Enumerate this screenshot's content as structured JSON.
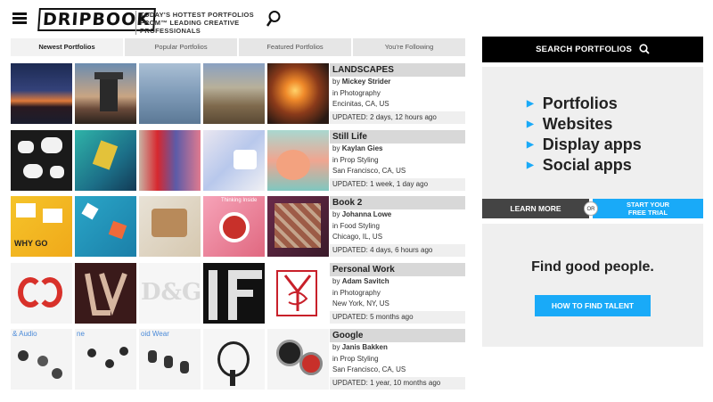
{
  "header": {
    "logo": "DRIPBOOK",
    "tagline": "TODAY'S HOTTEST PORTFOLIOS FROM™ LEADING CREATIVE PROFESSIONALS"
  },
  "tabs": [
    {
      "label": "Newest Portfolios",
      "active": true
    },
    {
      "label": "Popular Portfolios",
      "active": false
    },
    {
      "label": "Featured Portfolios",
      "active": false
    },
    {
      "label": "You're Following",
      "active": false
    }
  ],
  "portfolios": [
    {
      "title": "LANDSCAPES",
      "by": "by",
      "author": "Mickey Strider",
      "category": "in Photography",
      "location": "Encinitas, CA, US",
      "updated": "UPDATED: 2 days, 12 hours ago"
    },
    {
      "title": "Still Life",
      "by": "by",
      "author": "Kaylan Gies",
      "category": "in Prop Styling",
      "location": "San Francisco, CA, US",
      "updated": "UPDATED: 1 week, 1 day ago"
    },
    {
      "title": "Book 2",
      "by": "by",
      "author": "Johanna Lowe",
      "category": "in Food Styling",
      "location": "Chicago, IL, US",
      "updated": "UPDATED: 4 days, 6 hours ago"
    },
    {
      "title": "Personal Work",
      "by": "by",
      "author": "Adam Savitch",
      "category": "in Photography",
      "location": "New York, NY, US",
      "updated": "UPDATED: 5 months ago"
    },
    {
      "title": "Google",
      "by": "by",
      "author": "Janis Bakken",
      "category": "in Prop Styling",
      "location": "San Francisco, CA, US",
      "updated": "UPDATED: 1 year, 10 months ago"
    }
  ],
  "thumb_text": {
    "why_go": "WHY GO",
    "thinking": "Thinking Inside",
    "dg": "D&G",
    "audio": "& Audio",
    "ne": "ne",
    "oid_wear": "oid Wear"
  },
  "sidebar": {
    "search_label": "SEARCH PORTFOLIOS",
    "promo_items": [
      "Portfolios",
      "Websites",
      "Display apps",
      "Social apps"
    ],
    "learn_more": "LEARN MORE",
    "or": "OR",
    "trial_line1": "START YOUR",
    "trial_line2": "FREE TRIAL",
    "talent_heading": "Find good people.",
    "talent_button": "HOW TO FIND TALENT"
  },
  "colors": {
    "accent": "#19aaf8",
    "black_bar": "#000000",
    "panel": "#efefef"
  }
}
